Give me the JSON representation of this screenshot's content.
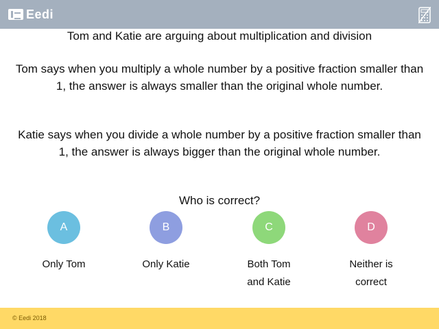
{
  "brand": {
    "name": "Eedi"
  },
  "header": {
    "calculator_icon": "calculator-off-icon"
  },
  "question": {
    "title": "Tom and Katie are arguing about multiplication and division",
    "tom_statement": "Tom says when you multiply a whole number by a positive fraction smaller than 1, the answer is always smaller than the original whole number.",
    "katie_statement": "Katie says when you divide a whole number by a positive fraction smaller than 1, the answer is always bigger than the original whole number.",
    "prompt": "Who is correct?"
  },
  "options": [
    {
      "letter": "A",
      "text": "Only Tom",
      "color": "#6bbfe0"
    },
    {
      "letter": "B",
      "text": "Only Katie",
      "color": "#8e9ee0"
    },
    {
      "letter": "C",
      "text": "Both Tom and Katie",
      "color": "#8ed87a"
    },
    {
      "letter": "D",
      "text": "Neither is correct",
      "color": "#e0829e"
    }
  ],
  "footer": {
    "copyright": "© Eedi 2018"
  },
  "colors": {
    "topbar": "#a4b0be",
    "footer": "#ffd966"
  }
}
